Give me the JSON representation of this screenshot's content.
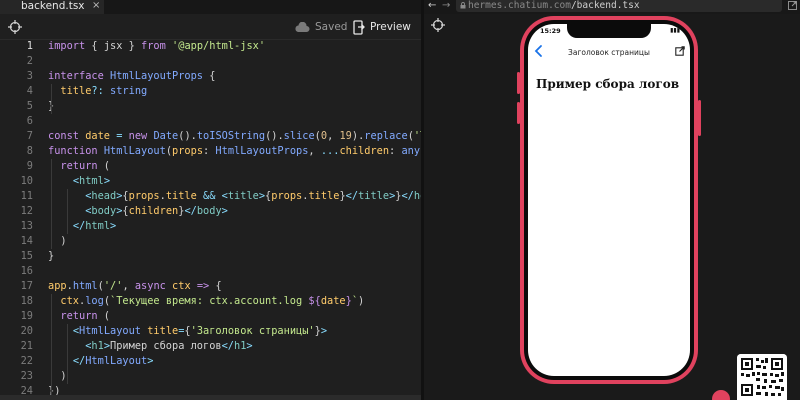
{
  "editor": {
    "tab": {
      "label": "backend.tsx",
      "close_glyph": "×"
    },
    "toolbar": {
      "saved_label": "Saved",
      "preview_label": "Preview"
    }
  },
  "preview": {
    "url": {
      "host": "hermes.chatium.com",
      "path": "/backend.tsx"
    },
    "phone": {
      "clock": "15:29",
      "nav_title": "Заголовок страницы",
      "heading": "Пример сбора логов"
    }
  },
  "colors": {
    "accent": "#e0425e",
    "keyword": "#c792ea",
    "string": "#c3e88d",
    "type": "#82aaff",
    "tag": "#80cbc4",
    "ios_blue": "#1a73e8"
  },
  "icons": [
    "crosshair-icon",
    "cloud-icon",
    "preview-icon",
    "lock-icon",
    "back-icon",
    "share-icon",
    "qr-code-icon"
  ],
  "code_lines": [
    {
      "n": "1",
      "html": "<span class=\"kw\">import</span> { <span class=\"pl\">jsx</span> } <span class=\"kw\">from</span> <span class=\"st\">'@app/html-jsx'</span>"
    },
    {
      "n": "2",
      "html": ""
    },
    {
      "n": "3",
      "html": "<span class=\"kw\">interface</span> <span class=\"ty\">HtmlLayoutProps</span> {"
    },
    {
      "n": "4",
      "html": "  <span class=\"pr\">title</span><span class=\"op\">?:</span> <span class=\"ty\">string</span>"
    },
    {
      "n": "5",
      "html": "}"
    },
    {
      "n": "6",
      "html": ""
    },
    {
      "n": "7",
      "html": "<span class=\"kw\">const</span> <span class=\"pr\">date</span> <span class=\"op\">=</span> <span class=\"kw\">new</span> <span class=\"ty\">Date</span>().<span class=\"bl\">toISOString</span>().<span class=\"bl\">slice</span>(<span class=\"fn\">0</span>, <span class=\"fn\">19</span>).<span class=\"bl\">replace</span>(<span class=\"st\">'T'</span>,"
    },
    {
      "n": "8",
      "html": "<span class=\"kw\">function</span> <span class=\"ty\">HtmlLayout</span>(<span class=\"pr\">props</span>: <span class=\"ty\">HtmlLayoutProps</span>, <span class=\"op\">...</span><span class=\"pr\">children</span>: <span class=\"ty\">any</span>) {"
    },
    {
      "n": "9",
      "html": "  <span class=\"kw\">return</span> ("
    },
    {
      "n": "10",
      "html": "    <span class=\"op\">&lt;</span><span class=\"tg\">html</span><span class=\"op\">&gt;</span>"
    },
    {
      "n": "11",
      "html": "      <span class=\"op\">&lt;</span><span class=\"tg\">head</span><span class=\"op\">&gt;</span>{<span class=\"pr\">props</span>.<span class=\"pr\">title</span> <span class=\"op\">&amp;&amp;</span> <span class=\"op\">&lt;</span><span class=\"tg\">title</span><span class=\"op\">&gt;</span>{<span class=\"pr\">props</span>.<span class=\"pr\">title</span>}<span class=\"op\">&lt;/</span><span class=\"tg\">title</span><span class=\"op\">&gt;</span>}<span class=\"op\">&lt;/</span><span class=\"tg\">head</span><span class=\"op\">&gt;</span>"
    },
    {
      "n": "12",
      "html": "      <span class=\"op\">&lt;</span><span class=\"tg\">body</span><span class=\"op\">&gt;</span>{<span class=\"pr\">children</span>}<span class=\"op\">&lt;/</span><span class=\"tg\">body</span><span class=\"op\">&gt;</span>"
    },
    {
      "n": "13",
      "html": "    <span class=\"op\">&lt;/</span><span class=\"tg\">html</span><span class=\"op\">&gt;</span>"
    },
    {
      "n": "14",
      "html": "  )"
    },
    {
      "n": "15",
      "html": "}"
    },
    {
      "n": "16",
      "html": ""
    },
    {
      "n": "17",
      "html": "<span class=\"pr\">app</span>.<span class=\"bl\">html</span>(<span class=\"st\">'/'</span>, <span class=\"kw\">async</span> <span class=\"pr\">ctx</span> <span class=\"kw\">=&gt;</span> {"
    },
    {
      "n": "18",
      "html": "  <span class=\"pr\">ctx</span>.<span class=\"bl\">log</span>(<span class=\"st\">`Текущее время: ctx.account.log </span><span class=\"kw\">${</span><span class=\"pr\">date</span><span class=\"kw\">}</span><span class=\"st\">`</span>)"
    },
    {
      "n": "19",
      "html": "  <span class=\"kw\">return</span> ("
    },
    {
      "n": "20",
      "html": "    <span class=\"op\">&lt;</span><span class=\"ty\">HtmlLayout</span> <span class=\"at\">title</span><span class=\"op\">=</span>{<span class=\"st\">'Заголовок страницы'</span>}<span class=\"op\">&gt;</span>"
    },
    {
      "n": "21",
      "html": "      <span class=\"op\">&lt;</span><span class=\"tg\">h1</span><span class=\"op\">&gt;</span>Пример сбора логов<span class=\"op\">&lt;/</span><span class=\"tg\">h1</span><span class=\"op\">&gt;</span>"
    },
    {
      "n": "22",
      "html": "    <span class=\"op\">&lt;/</span><span class=\"ty\">HtmlLayout</span><span class=\"op\">&gt;</span>"
    },
    {
      "n": "23",
      "html": "  )"
    },
    {
      "n": "24",
      "html": "})"
    }
  ]
}
